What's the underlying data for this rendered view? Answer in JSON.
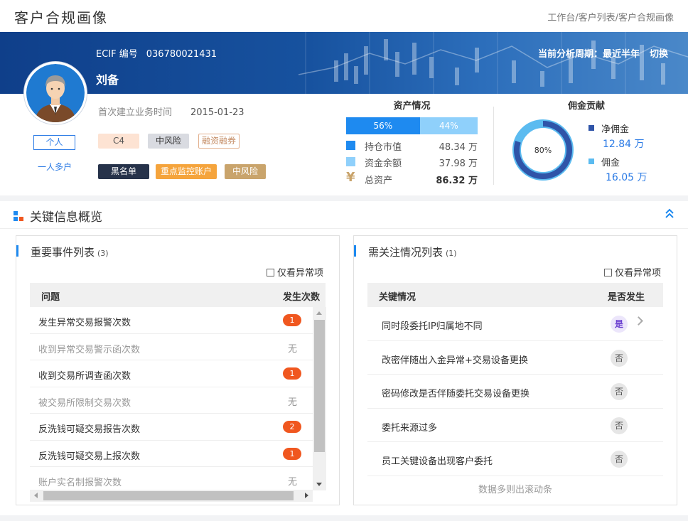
{
  "header": {
    "title": "客户合规画像",
    "breadcrumb": "工作台/客户列表/客户合规画像"
  },
  "profile": {
    "ecif_label": "ECIF 编号",
    "ecif_number": "036780021431",
    "name": "刘备",
    "period_label": "当前分析周期：最近半年",
    "switch_label": "切换",
    "customer_type": "个人",
    "multi_account_label": "一人多户",
    "first_business_label": "首次建立业务时间",
    "first_business_date": "2015-01-23",
    "tags": [
      "C4",
      "中风险",
      "融资融券",
      "黑名单",
      "重点监控账户",
      "中风险"
    ]
  },
  "assets": {
    "title": "资产情况",
    "market_pct": 56,
    "market_pct_label": "56%",
    "cash_pct_label": "44%",
    "rows": [
      {
        "label": "持仓市值",
        "value": "48.34 万",
        "color": "#1e8af0"
      },
      {
        "label": "资金余额",
        "value": "37.98 万",
        "color": "#8fd0fb"
      },
      {
        "label": "总资产",
        "value": "86.32 万",
        "icon": "yen-icon"
      }
    ]
  },
  "commission": {
    "title": "佣金贡献",
    "net_pct": 80,
    "center_label": "80%",
    "net_label": "净佣金",
    "net_value": "12.84 万",
    "total_label": "佣金",
    "total_value": "16.05 万",
    "net_color": "#2f54a8",
    "total_color": "#5bbbf0"
  },
  "overview": {
    "title": "关键信息概览",
    "events": {
      "title": "重要事件列表",
      "count": "(3)",
      "filter_label": "仅看异常项",
      "col_issue": "问题",
      "col_count": "发生次数",
      "rows": [
        {
          "label": "发生异常交易报警次数",
          "count": "1",
          "abnormal": true
        },
        {
          "label": "收到异常交易警示函次数",
          "count": "无",
          "abnormal": false
        },
        {
          "label": "收到交易所调查函次数",
          "count": "1",
          "abnormal": true
        },
        {
          "label": "被交易所限制交易次数",
          "count": "无",
          "abnormal": false
        },
        {
          "label": "反洗钱可疑交易报告次数",
          "count": "2",
          "abnormal": true
        },
        {
          "label": "反洗钱可疑交易上报次数",
          "count": "1",
          "abnormal": true
        },
        {
          "label": "账户实名制报警次数",
          "count": "无",
          "abnormal": false
        }
      ]
    },
    "attention": {
      "title": "需关注情况列表",
      "count": "(1)",
      "filter_label": "仅看异常项",
      "col_key": "关键情况",
      "col_occur": "是否发生",
      "rows": [
        {
          "label": "同时段委托IP归属地不同",
          "value": "是",
          "yes": true
        },
        {
          "label": "改密伴随出入金异常+交易设备更换",
          "value": "否",
          "yes": false
        },
        {
          "label": "密码修改是否伴随委托交易设备更换",
          "value": "否",
          "yes": false
        },
        {
          "label": "委托来源过多",
          "value": "否",
          "yes": false
        },
        {
          "label": "员工关键设备出现客户委托",
          "value": "否",
          "yes": false
        }
      ],
      "scroll_hint": "数据多则出滚动条"
    }
  }
}
